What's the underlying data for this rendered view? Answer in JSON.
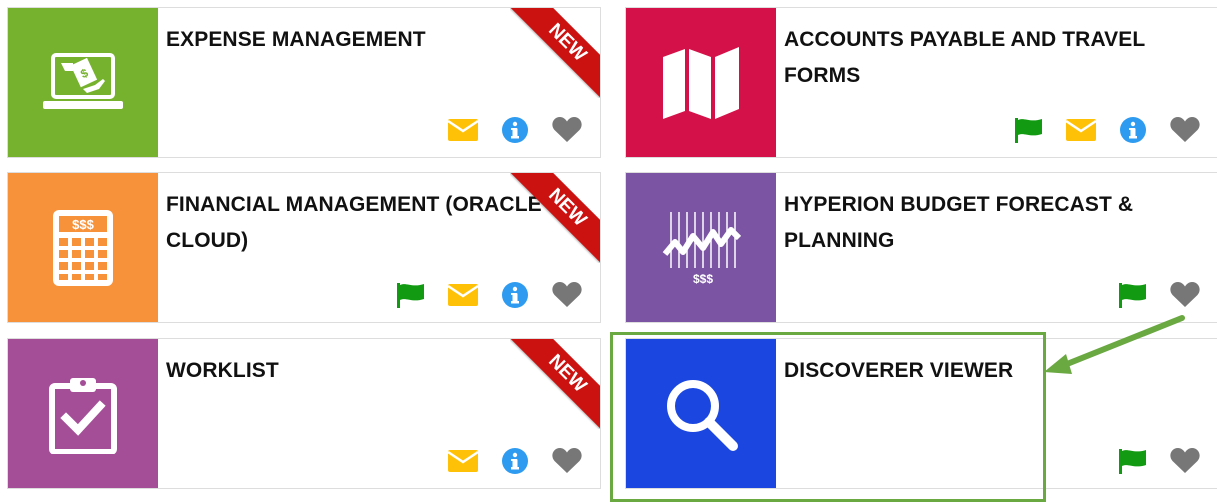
{
  "tiles": [
    {
      "title": "EXPENSE MANAGEMENT",
      "ribbon": "NEW",
      "icon": "laptop-money-icon",
      "color": "#77b22f"
    },
    {
      "title": "ACCOUNTS PAYABLE AND TRAVEL FORMS",
      "icon": "map-icon",
      "color": "#d41148"
    },
    {
      "title": "FINANCIAL MANAGEMENT (ORACLE CLOUD)",
      "ribbon": "NEW",
      "icon": "calculator-icon",
      "color": "#f7923b",
      "calculator_label": "$$$"
    },
    {
      "title": "HYPERION BUDGET FORECAST & PLANNING",
      "icon": "stock-chart-icon",
      "color": "#7b54a3",
      "chart_label": "$$$"
    },
    {
      "title": "WORKLIST",
      "ribbon": "NEW",
      "icon": "clipboard-check-icon",
      "color": "#a44e97"
    },
    {
      "title": "DISCOVERER VIEWER",
      "icon": "magnifier-icon",
      "color": "#1b47e0"
    }
  ],
  "colors": {
    "flag": "#129b12",
    "mail": "#ffc107",
    "info": "#2e9bf0",
    "heart": "#777777",
    "ribbon": "#cc1111",
    "highlight": "#6aa842"
  }
}
